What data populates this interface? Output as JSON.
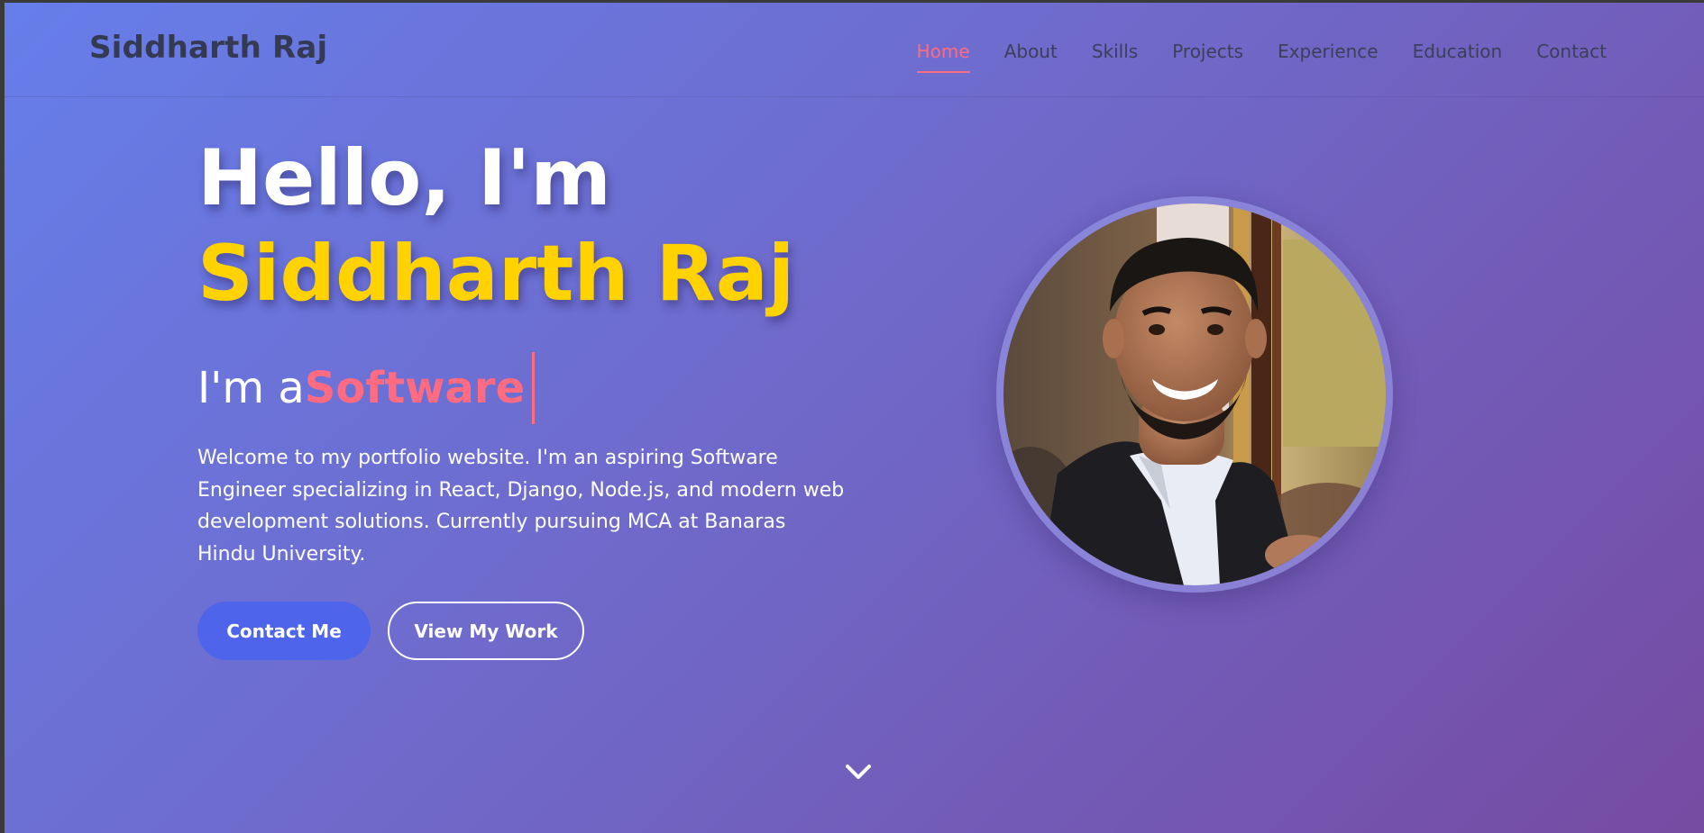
{
  "navbar": {
    "brand": "Siddharth Raj",
    "links": [
      {
        "label": "Home",
        "active": true
      },
      {
        "label": "About"
      },
      {
        "label": "Skills"
      },
      {
        "label": "Projects"
      },
      {
        "label": "Experience"
      },
      {
        "label": "Education"
      },
      {
        "label": "Contact"
      }
    ]
  },
  "hero": {
    "greeting": "Hello, I'm",
    "name": "Siddharth Raj",
    "typing_prefix": "I'm a",
    "typing_word": "Software",
    "description": "Welcome to my portfolio website. I'm an aspiring Software Engineer specializing in React, Django, Node.js, and modern web development solutions. Currently pursuing MCA at Banaras Hindu University.",
    "primary_button": "Contact Me",
    "secondary_button": "View My Work"
  },
  "icons": {
    "scroll": "chevron-down-icon",
    "profile": "profile-photo"
  },
  "colors": {
    "accent": "#ff6b81",
    "name_highlight": "#ffd200",
    "primary_button": "#4e64eb",
    "gradient_start": "#667eea",
    "gradient_end": "#764ba2"
  }
}
